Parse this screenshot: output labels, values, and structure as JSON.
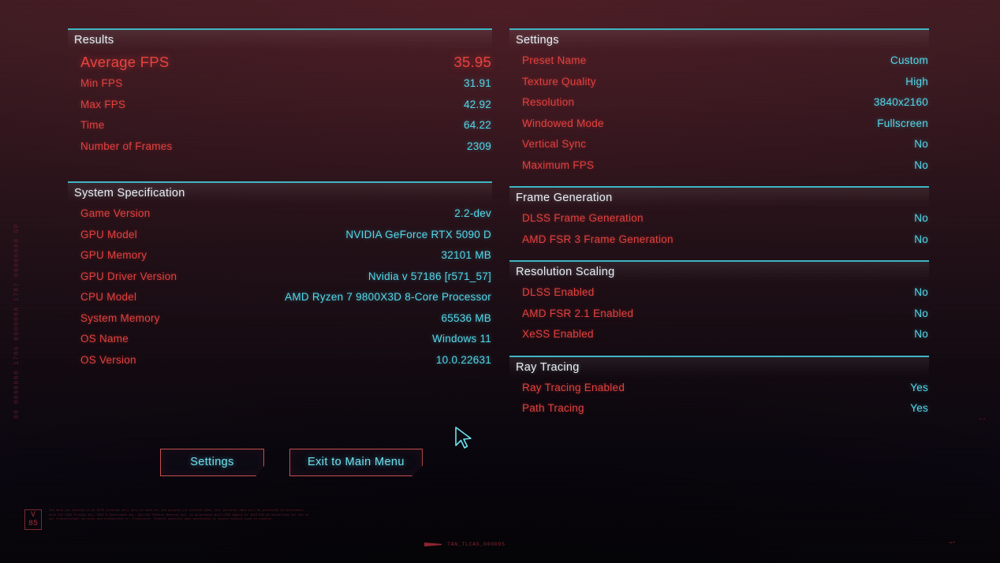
{
  "theme": {
    "accent_cyan": "#53d8ea",
    "accent_red": "#e2413f",
    "header_rule": "#3fb5c4",
    "background_top": "#3d1c22",
    "background_bottom": "#07050a"
  },
  "left_column": {
    "results": {
      "title": "Results",
      "featured": {
        "label": "Average FPS",
        "value": "35.95"
      },
      "rows": [
        {
          "label": "Min FPS",
          "value": "31.91"
        },
        {
          "label": "Max FPS",
          "value": "42.92"
        },
        {
          "label": "Time",
          "value": "64.22"
        },
        {
          "label": "Number of Frames",
          "value": "2309"
        }
      ]
    },
    "system_specification": {
      "title": "System Specification",
      "rows": [
        {
          "label": "Game Version",
          "value": "2.2-dev"
        },
        {
          "label": "GPU Model",
          "value": "NVIDIA GeForce RTX 5090 D"
        },
        {
          "label": "GPU Memory",
          "value": "32101 MB"
        },
        {
          "label": "GPU Driver Version",
          "value": "Nvidia v 57186 [r571_57]"
        },
        {
          "label": "CPU Model",
          "value": "AMD Ryzen 7 9800X3D 8-Core Processor"
        },
        {
          "label": "System Memory",
          "value": "65536 MB"
        },
        {
          "label": "OS Name",
          "value": "Windows 11"
        },
        {
          "label": "OS Version",
          "value": "10.0.22631"
        }
      ]
    }
  },
  "right_column": {
    "settings": {
      "title": "Settings",
      "rows": [
        {
          "label": "Preset Name",
          "value": "Custom"
        },
        {
          "label": "Texture Quality",
          "value": "High"
        },
        {
          "label": "Resolution",
          "value": "3840x2160"
        },
        {
          "label": "Windowed Mode",
          "value": "Fullscreen"
        },
        {
          "label": "Vertical Sync",
          "value": "No"
        },
        {
          "label": "Maximum FPS",
          "value": "No"
        }
      ]
    },
    "frame_generation": {
      "title": "Frame Generation",
      "rows": [
        {
          "label": "DLSS Frame Generation",
          "value": "No"
        },
        {
          "label": "AMD FSR 3 Frame Generation",
          "value": "No"
        }
      ]
    },
    "resolution_scaling": {
      "title": "Resolution Scaling",
      "rows": [
        {
          "label": "DLSS Enabled",
          "value": "No"
        },
        {
          "label": "AMD FSR 2.1 Enabled",
          "value": "No"
        },
        {
          "label": "XeSS Enabled",
          "value": "No"
        }
      ]
    },
    "ray_tracing": {
      "title": "Ray Tracing",
      "rows": [
        {
          "label": "Ray Tracing Enabled",
          "value": "Yes"
        },
        {
          "label": "Path Tracing",
          "value": "Yes"
        }
      ]
    }
  },
  "buttons": {
    "settings_label": "Settings",
    "exit_label": "Exit to Main Menu"
  },
  "chrome": {
    "left_edge_code": "00 0000000 1786 0000000 1787 00000000 GP",
    "version_badge_line1": "V",
    "version_badge_line2": "85",
    "legal_text": "The data you entered on an NCPD terminal will only be used for the purpose you entered them. Your personal data will be protected in accordance with the 2069 Privacy Act, 2067 E-Government Act, and the Federal Records Act, in accordance with CIRA Agency Nr 1023-543-AS Guidelines for use of but transactional services and transaction nr. Procedures. Federal agencies have permission to access cookies used to execute.",
    "footer_code": "TAN_TLCAS_000095",
    "mark_right_mid": "▸▪",
    "mark_right_low": "▬▸"
  },
  "cursor": {
    "name": "pointer-arrow"
  }
}
